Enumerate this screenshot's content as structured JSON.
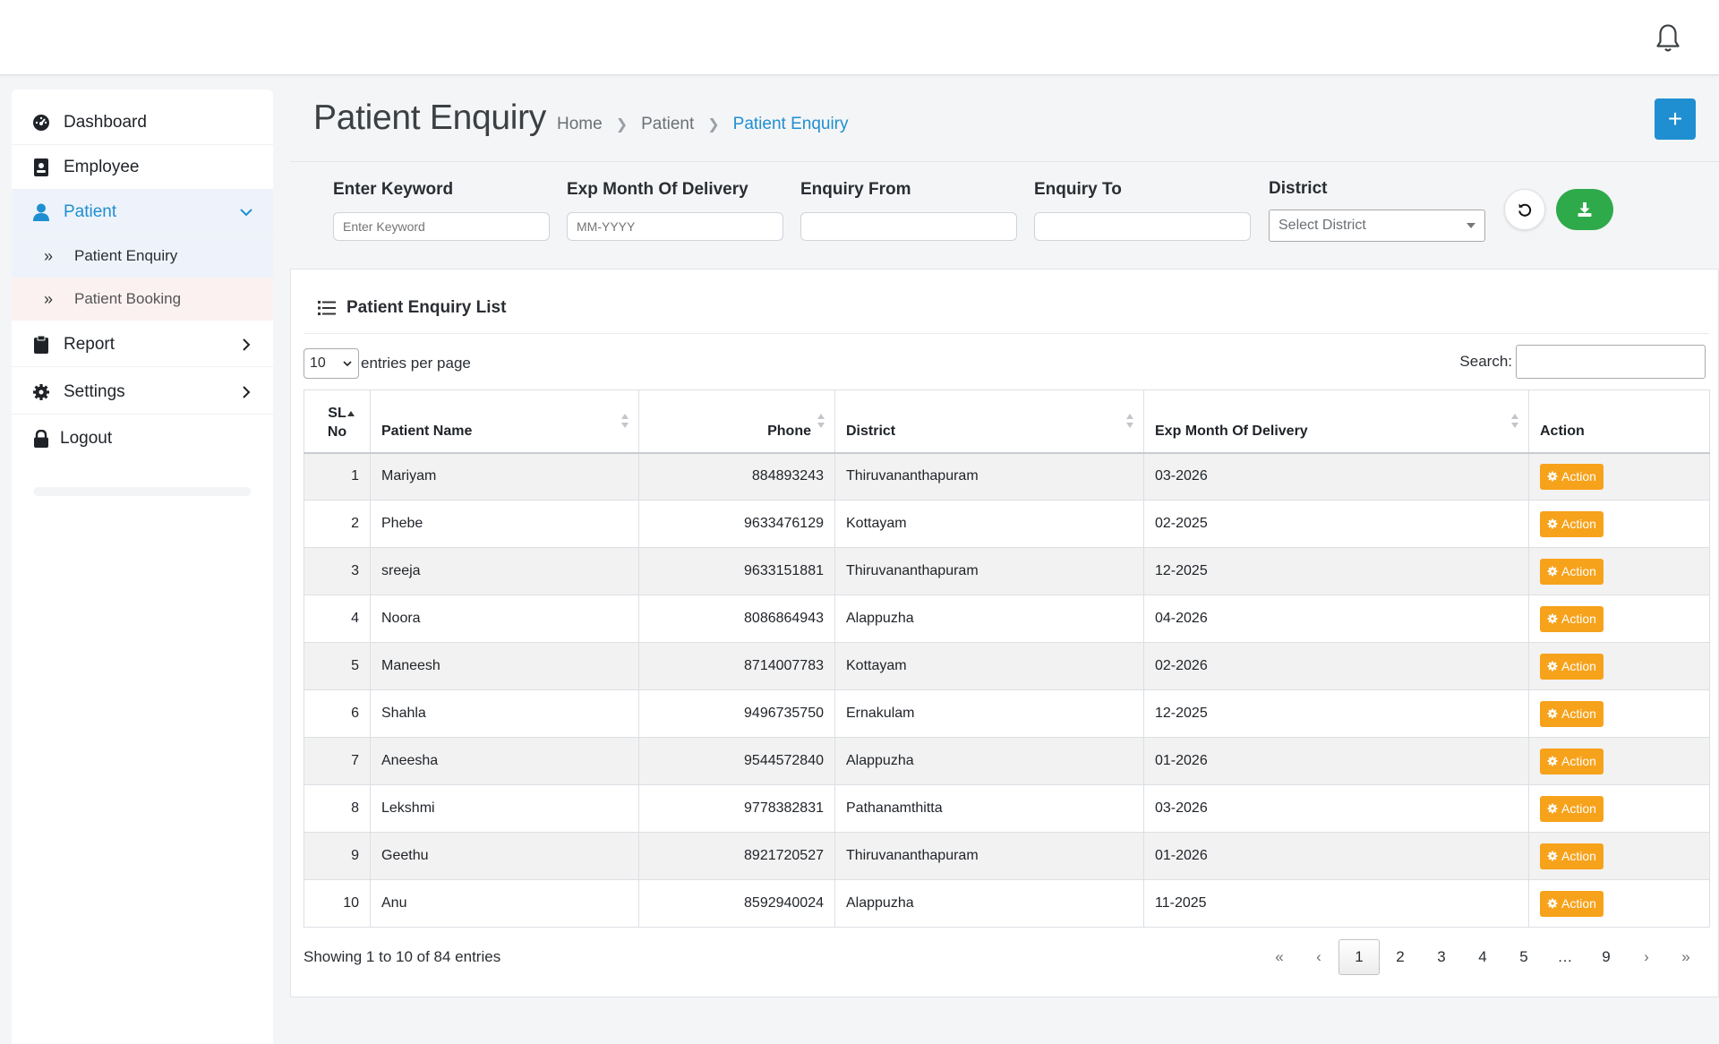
{
  "sidebar": {
    "items": [
      {
        "label": "Dashboard",
        "icon": "dashboard-icon"
      },
      {
        "label": "Employee",
        "icon": "id-badge-icon"
      },
      {
        "label": "Patient",
        "icon": "user-icon"
      },
      {
        "label": "Report",
        "icon": "clipboard-icon"
      },
      {
        "label": "Settings",
        "icon": "gear-icon"
      },
      {
        "label": "Logout",
        "icon": "lock-icon"
      }
    ],
    "sub_items": [
      "Patient Enquiry",
      "Patient Booking"
    ]
  },
  "header": {
    "title": "Patient Enquiry",
    "breadcrumb": [
      "Home",
      "Patient",
      "Patient Enquiry"
    ],
    "add_label": "+"
  },
  "filters": {
    "keyword": {
      "label": "Enter Keyword",
      "placeholder": "Enter Keyword",
      "value": ""
    },
    "exp_month": {
      "label": "Exp Month Of Delivery",
      "placeholder": "MM-YYYY",
      "value": ""
    },
    "enquiry_from": {
      "label": "Enquiry From",
      "value": ""
    },
    "enquiry_to": {
      "label": "Enquiry To",
      "value": ""
    },
    "district": {
      "label": "District",
      "selected": "Select District"
    }
  },
  "list": {
    "title": "Patient Enquiry List",
    "entries_value": "10",
    "entries_label": "entries per page",
    "search_label": "Search:",
    "search_value": "",
    "columns": [
      "SL No",
      "Patient Name",
      "Phone",
      "District",
      "Exp Month Of Delivery",
      "Action"
    ],
    "action_label": "Action",
    "rows": [
      {
        "sl": "1",
        "name": "Mariyam",
        "phone": "884893243",
        "district": "Thiruvananthapuram",
        "exp": "03-2026"
      },
      {
        "sl": "2",
        "name": "Phebe",
        "phone": "9633476129",
        "district": "Kottayam",
        "exp": "02-2025"
      },
      {
        "sl": "3",
        "name": "sreeja",
        "phone": "9633151881",
        "district": "Thiruvananthapuram",
        "exp": "12-2025"
      },
      {
        "sl": "4",
        "name": "Noora",
        "phone": "8086864943",
        "district": "Alappuzha",
        "exp": "04-2026"
      },
      {
        "sl": "5",
        "name": "Maneesh",
        "phone": "8714007783",
        "district": "Kottayam",
        "exp": "02-2026"
      },
      {
        "sl": "6",
        "name": "Shahla",
        "phone": "9496735750",
        "district": "Ernakulam",
        "exp": "12-2025"
      },
      {
        "sl": "7",
        "name": "Aneesha",
        "phone": "9544572840",
        "district": "Alappuzha",
        "exp": "01-2026"
      },
      {
        "sl": "8",
        "name": "Lekshmi",
        "phone": "9778382831",
        "district": "Pathanamthitta",
        "exp": "03-2026"
      },
      {
        "sl": "9",
        "name": "Geethu",
        "phone": "8921720527",
        "district": "Thiruvananthapuram",
        "exp": "01-2026"
      },
      {
        "sl": "10",
        "name": "Anu",
        "phone": "8592940024",
        "district": "Alappuzha",
        "exp": "11-2025"
      }
    ],
    "info": "Showing 1 to 10 of 84 entries",
    "pagination": [
      "«",
      "‹",
      "1",
      "2",
      "3",
      "4",
      "5",
      "…",
      "9",
      "›",
      "»"
    ],
    "current_page": "1"
  },
  "colors": {
    "accent": "#1f8fd1",
    "action_button": "#f7a21b",
    "download_button": "#2eaa4a"
  }
}
